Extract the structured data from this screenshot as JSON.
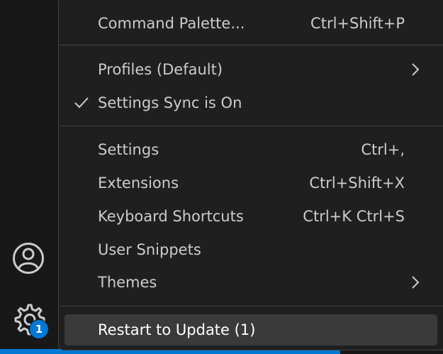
{
  "menu": {
    "items": [
      {
        "label": "Command Palette...",
        "keybinding": "Ctrl+Shift+P"
      },
      {
        "label": "Profiles (Default)",
        "submenu": true
      },
      {
        "label": "Settings Sync is On",
        "checked": true
      },
      {
        "label": "Settings",
        "keybinding": "Ctrl+,"
      },
      {
        "label": "Extensions",
        "keybinding": "Ctrl+Shift+X"
      },
      {
        "label": "Keyboard Shortcuts",
        "keybinding": "Ctrl+K Ctrl+S"
      },
      {
        "label": "User Snippets"
      },
      {
        "label": "Themes",
        "submenu": true
      },
      {
        "label": "Restart to Update (1)",
        "focused": true
      }
    ]
  },
  "activity_bar": {
    "icons": [
      "account-icon",
      "manage-gear-icon"
    ],
    "manage_badge": "1"
  },
  "colors": {
    "menu_background": "#1f1f1f",
    "menu_text": "#cccccc",
    "focused_item": "#3a3a3a",
    "separator": "#454545",
    "badge": "#0078d4",
    "status_bar": "#0078d4"
  }
}
